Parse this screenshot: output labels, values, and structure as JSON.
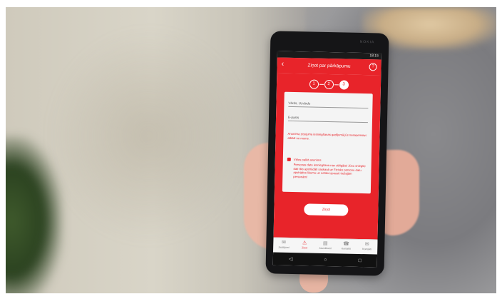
{
  "status": {
    "time": "18:15"
  },
  "device_brand": "NOKIA",
  "app": {
    "title": "Ziņot par pārkāpumu",
    "steps": [
      "1",
      "2",
      "3"
    ],
    "active_step": 3,
    "fields": {
      "name_placeholder": "Vārds, Uzvārds",
      "email_placeholder": "E-pasts"
    },
    "warning_text": "Anonīma ziņojuma iesniegšanas gadījumā jūs nesaņemsiet atbildi no mums.",
    "anonymous_label": "Vēlos palikt anonīms",
    "anonymous_checked": true,
    "consent_text": "Personas datu iesniegšana nav obligāta! Jūsu sniegtie dati tiks apstrādāti saskaņā ar Fizisko personu datu apstrādes likumu un netiks izpausti trešajām personām!",
    "send_label": "Ziņot"
  },
  "tabs": [
    {
      "label": "Jautājumi",
      "icon": "chat-icon"
    },
    {
      "label": "Ziņot",
      "icon": "warning-icon",
      "active": true
    },
    {
      "label": "Jaunākumi",
      "icon": "news-icon"
    },
    {
      "label": "Kontakti",
      "icon": "contacts-icon"
    },
    {
      "label": "Kontakti",
      "icon": "mail-icon"
    }
  ],
  "colors": {
    "brand_red": "#e8242a"
  }
}
